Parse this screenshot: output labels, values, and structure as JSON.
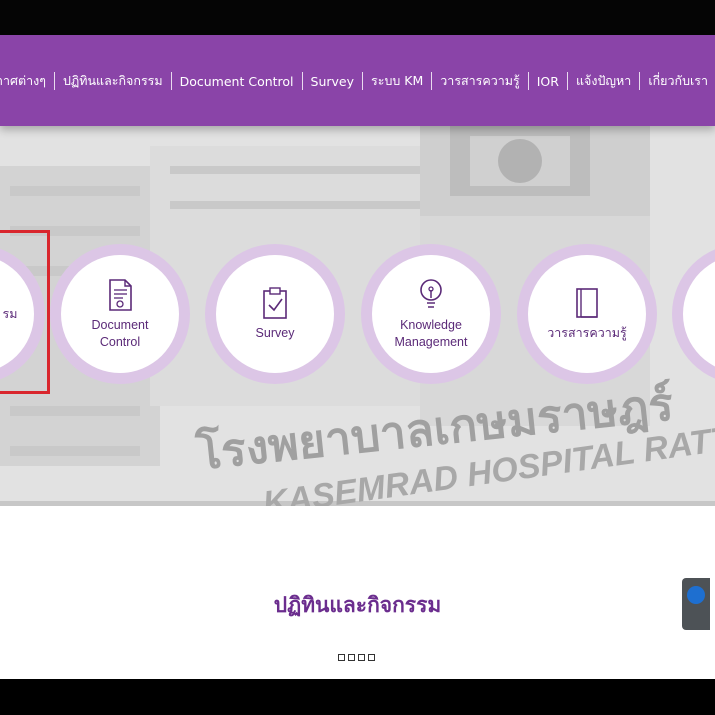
{
  "nav": {
    "items": [
      {
        "label": "าาศต่างๆ"
      },
      {
        "label": "ปฏิทินและกิจกรรม"
      },
      {
        "label": "Document Control"
      },
      {
        "label": "Survey"
      },
      {
        "label": "ระบบ KM"
      },
      {
        "label": "วารสารความรู้"
      },
      {
        "label": "IOR"
      },
      {
        "label": "แจ้งปัญหา"
      },
      {
        "label": "เกี่ยวกับเรา"
      }
    ]
  },
  "hero": {
    "background_text_line1": "โรงพยาบาลเกษมราษฎร์",
    "background_text_line2": "KASEMRAD HOSPITAL RATTAN",
    "cards": [
      {
        "label": "รม",
        "icon": "calendar-icon"
      },
      {
        "label": "Document\nControl",
        "icon": "document-certificate-icon"
      },
      {
        "label": "Survey",
        "icon": "clipboard-check-icon"
      },
      {
        "label": "Knowledge\nManagement",
        "icon": "lightbulb-icon"
      },
      {
        "label": "วารสารความรู้",
        "icon": "book-icon"
      },
      {
        "label": "",
        "icon": "partial-card"
      }
    ]
  },
  "main": {
    "section_title": "ปฏิทินและกิจกรรม",
    "slider_dots": 4
  },
  "colors": {
    "brand_purple": "#8a44a8",
    "title_purple": "#6b2d8e",
    "highlight_red": "#d9262d"
  }
}
